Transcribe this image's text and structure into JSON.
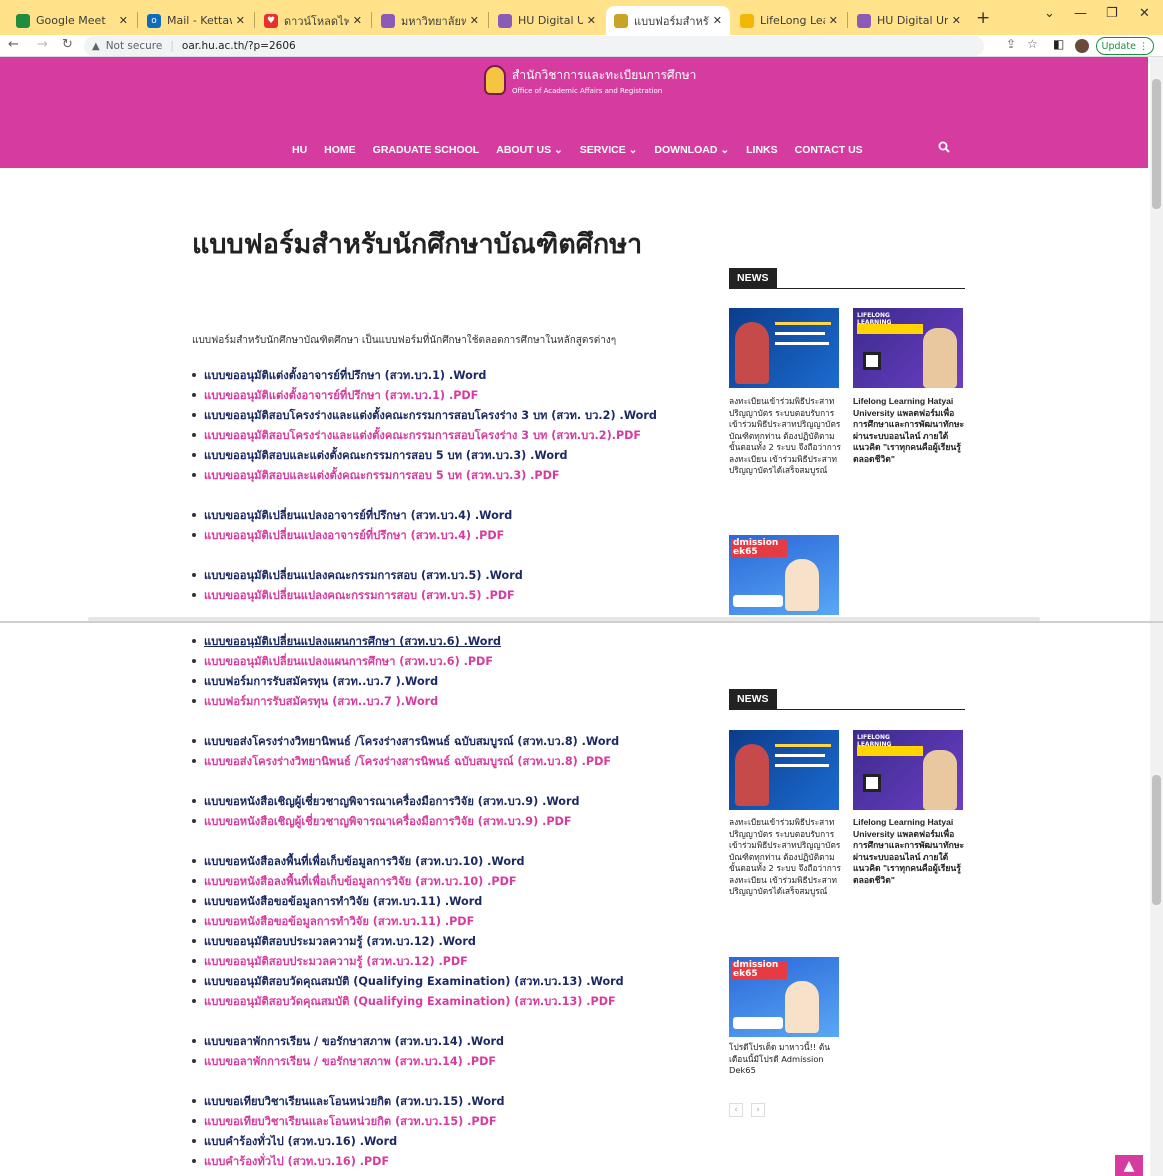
{
  "browser": {
    "tabs": [
      {
        "title": "Google Meet",
        "favicon_color": "#1e8e3e",
        "active": false
      },
      {
        "title": "Mail - Kettawa Boo",
        "favicon_color": "#0f6cbd",
        "active": false
      },
      {
        "title": "ดาวน์โหลดไฟล์ | iLov",
        "favicon_color": "#e5322d",
        "active": false
      },
      {
        "title": "มหาวิทยาลัยหาดใหญ่",
        "favicon_color": "#8a5cb8",
        "active": false
      },
      {
        "title": "HU Digital Univers",
        "favicon_color": "#8a5cb8",
        "active": false
      },
      {
        "title": "แบบฟอร์มสำหรับนักศึ",
        "favicon_color": "#c9a227",
        "active": true
      },
      {
        "title": "LifeLong Learning",
        "favicon_color": "#f2b705",
        "active": false
      },
      {
        "title": "HU Digital Univers",
        "favicon_color": "#8a5cb8",
        "active": false
      }
    ],
    "security_label": "Not secure",
    "url": "oar.hu.ac.th/?p=2606",
    "update_label": "Update"
  },
  "site": {
    "logo_th": "สำนักวิชาการและทะเบียนการศึกษา",
    "logo_en": "Office of Academic Affairs and Registration",
    "nav": [
      {
        "label": "HU"
      },
      {
        "label": "HOME"
      },
      {
        "label": "GRADUATE SCHOOL"
      },
      {
        "label": "ABOUT US ⌄"
      },
      {
        "label": "SERVICE ⌄"
      },
      {
        "label": "DOWNLOAD ⌄"
      },
      {
        "label": "LINKS"
      },
      {
        "label": "CONTACT US"
      }
    ],
    "accent_color": "#d63c9f"
  },
  "content": {
    "title": "แบบฟอร์มสำหรับนักศึกษาบัณฑิตศึกษา",
    "intro": "แบบฟอร์มสำหรับนักศึกษาบัณฑิตศึกษา เป็นแบบฟอร์มที่นักศึกษาใช้ตลอดการศึกษาในหลักสูตรต่างๆ",
    "forms": [
      {
        "text": "แบบขออนุมัติแต่งตั้งอาจารย์ที่ปรึกษา (สวท.บว.1) .Word",
        "kind": "word"
      },
      {
        "text": "แบบขออนุมัติแต่งตั้งอาจารย์ที่ปรึกษา (สวท.บว.1) .PDF",
        "kind": "pdf"
      },
      {
        "text": "แบบขออนุมัติสอบโครงร่างและแต่งตั้งคณะกรรมการสอบโครงร่าง 3 บท (สวท. บว.2) .Word",
        "kind": "word"
      },
      {
        "text": "แบบขออนุมัติสอบโครงร่างและแต่งตั้งคณะกรรมการสอบโครงร่าง 3 บท (สวท.บว.2).PDF",
        "kind": "pdf"
      },
      {
        "text": "แบบขออนุมัติสอบและแต่งตั้งคณะกรรมการสอบ 5 บท (สวท.บว.3) .Word",
        "kind": "word"
      },
      {
        "text": "แบบขออนุมัติสอบและแต่งตั้งคณะกรรมการสอบ 5 บท (สวท.บว.3) .PDF",
        "kind": "pdf"
      },
      {
        "text": "แบบขออนุมัติเปลี่ยนแปลงอาจารย์ที่ปรึกษา (สวท.บว.4) .Word",
        "kind": "word"
      },
      {
        "text": "แบบขออนุมัติเปลี่ยนแปลงอาจารย์ที่ปรึกษา (สวท.บว.4) .PDF",
        "kind": "pdf"
      },
      {
        "text": "แบบขออนุมัติเปลี่ยนแปลงคณะกรรมการสอบ (สวท.บว.5) .Word",
        "kind": "word"
      },
      {
        "text": "แบบขออนุมัติเปลี่ยนแปลงคณะกรรมการสอบ (สวท.บว.5) .PDF",
        "kind": "pdf"
      },
      {
        "text": "แบบขออนุมัติเปลี่ยนแปลงแผนการศึกษา (สวท.บว.6) .Word",
        "kind": "word"
      },
      {
        "text": "แบบขออนุมัติเปลี่ยนแปลงแผนการศึกษา (สวท.บว.6) .PDF",
        "kind": "pdf"
      },
      {
        "text": "แบบฟอร์มการรับสมัครทุน (สวท..บว.7 ).Word",
        "kind": "word"
      },
      {
        "text": "แบบฟอร์มการรับสมัครทุน (สวท..บว.7 ).Word",
        "kind": "pdf"
      },
      {
        "text": "แบบขอส่งโครงร่างวิทยานิพนธ์ /โครงร่างสารนิพนธ์ ฉบับสมบูรณ์ (สวท.บว.8) .Word",
        "kind": "word"
      },
      {
        "text": "แบบขอส่งโครงร่างวิทยานิพนธ์ /โครงร่างสารนิพนธ์ ฉบับสมบูรณ์ (สวท.บว.8) .PDF",
        "kind": "pdf"
      },
      {
        "text": "แบบขอหนังสือเชิญผู้เชี่ยวชาญพิจารณาเครื่องมือการวิจัย (สวท.บว.9) .Word",
        "kind": "word"
      },
      {
        "text": "แบบขอหนังสือเชิญผู้เชี่ยวชาญพิจารณาเครื่องมือการวิจัย (สวท.บว.9) .PDF",
        "kind": "pdf"
      },
      {
        "text": "แบบขอหนังสือลงพื้นที่เพื่อเก็บข้อมูลการวิจัย (สวท.บว.10) .Word",
        "kind": "word"
      },
      {
        "text": "แบบขอหนังสือลงพื้นที่เพื่อเก็บข้อมูลการวิจัย (สวท.บว.10) .PDF",
        "kind": "pdf"
      },
      {
        "text": "แบบขอหนังสือขอข้อมูลการทำวิจัย (สวท.บว.11) .Word",
        "kind": "word"
      },
      {
        "text": "แบบขอหนังสือขอข้อมูลการทำวิจัย (สวท.บว.11) .PDF",
        "kind": "pdf"
      },
      {
        "text": "แบบขออนุมัติสอบประมวลความรู้ (สวท.บว.12) .Word",
        "kind": "word"
      },
      {
        "text": "แบบขออนุมัติสอบประมวลความรู้ (สวท.บว.12) .PDF",
        "kind": "pdf"
      },
      {
        "text": "แบบขออนุมัติสอบวัดคุณสมบัติ (Qualifying Examination) (สวท.บว.13) .Word",
        "kind": "word"
      },
      {
        "text": "แบบขออนุมัติสอบวัดคุณสมบัติ (Qualifying Examination) (สวท.บว.13) .PDF",
        "kind": "pdf"
      },
      {
        "text": "แบบขอลาพักการเรียน / ขอรักษาสภาพ (สวท.บว.14) .Word",
        "kind": "word"
      },
      {
        "text": "แบบขอลาพักการเรียน / ขอรักษาสภาพ (สวท.บว.14) .PDF",
        "kind": "pdf"
      },
      {
        "text": "แบบขอเทียบวิชาเรียนและโอนหน่วยกิต (สวท.บว.15) .Word",
        "kind": "word"
      },
      {
        "text": "แบบขอเทียบวิชาเรียนและโอนหน่วยกิต (สวท.บว.15) .PDF",
        "kind": "pdf"
      },
      {
        "text": "แบบคำร้องทั่วไป (สวท.บว.16) .Word",
        "kind": "word"
      },
      {
        "text": "แบบคำร้องทั่วไป (สวท.บว.16) .PDF",
        "kind": "pdf"
      }
    ]
  },
  "sidebar": {
    "news_label": "NEWS",
    "items": [
      {
        "caption": "ลงทะเบียนเข้าร่วมพิธีประสาทปริญญาบัตร ระบบตอบรับการเข้าร่วมพิธีประสาทปริญญาบัตรบัณฑิตทุกท่าน ต้องปฏิบัติตามขั้นตอนทั้ง 2 ระบบ จึงถือว่าการลงทะเบียน เข้าร่วมพิธีประสาทปริญญาบัตรได้เสร็จสมบูรณ์"
      },
      {
        "caption": "Lifelong Learning Hatyai University แพลตฟอร์มเพื่อการศึกษาและการพัฒนาทักษะผ่านระบบออนไลน์ ภายใต้แนวคิด \"เราทุกคนคือผู้เรียนรู้ตลอดชีวิต\""
      },
      {
        "caption": "โปรดีโปรเด็ด มาหาวนี้!! ต้นเดือนนี้มีโปรดี Admission Dek65"
      }
    ],
    "img_b_header": "LIFELONG LEARNING",
    "img_c_tag": "dmission ek65"
  }
}
